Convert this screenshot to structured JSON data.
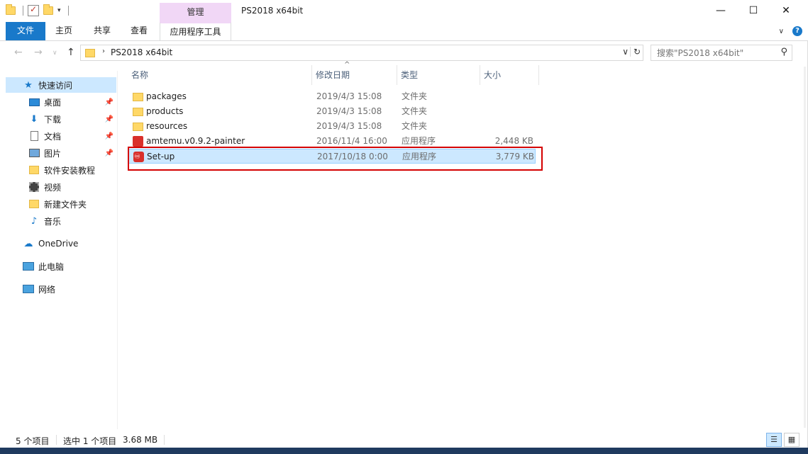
{
  "window": {
    "title": "PS2018 x64bit",
    "context_tab_group": "管理",
    "minimize": "—",
    "maximize": "☐",
    "close": "✕"
  },
  "ribbon": {
    "tabs": [
      "文件",
      "主页",
      "共享",
      "查看",
      "应用程序工具"
    ]
  },
  "address": {
    "path": "PS2018 x64bit",
    "search_placeholder": "搜索\"PS2018 x64bit\""
  },
  "nav_pane": {
    "quick_access": "快速访问",
    "items": [
      {
        "label": "桌面",
        "icon": "desktop-icon",
        "pinned": true
      },
      {
        "label": "下载",
        "icon": "download-icon",
        "pinned": true
      },
      {
        "label": "文档",
        "icon": "document-icon",
        "pinned": true
      },
      {
        "label": "图片",
        "icon": "pictures-icon",
        "pinned": true
      },
      {
        "label": "软件安装教程",
        "icon": "folder-icon",
        "pinned": false
      },
      {
        "label": "视频",
        "icon": "video-icon",
        "pinned": false
      },
      {
        "label": "新建文件夹",
        "icon": "folder-icon",
        "pinned": false
      },
      {
        "label": "音乐",
        "icon": "music-icon",
        "pinned": false
      }
    ],
    "onedrive": "OneDrive",
    "this_pc": "此电脑",
    "network": "网络"
  },
  "columns": {
    "name": "名称",
    "date": "修改日期",
    "type": "类型",
    "size": "大小"
  },
  "files": [
    {
      "name": "packages",
      "date": "2019/4/3 15:08",
      "type": "文件夹",
      "size": "",
      "icon": "folder-icon"
    },
    {
      "name": "products",
      "date": "2019/4/3 15:08",
      "type": "文件夹",
      "size": "",
      "icon": "folder-icon"
    },
    {
      "name": "resources",
      "date": "2019/4/3 15:08",
      "type": "文件夹",
      "size": "",
      "icon": "folder-icon"
    },
    {
      "name": "amtemu.v0.9.2-painter",
      "date": "2016/11/4 16:00",
      "type": "应用程序",
      "size": "2,448 KB",
      "icon": "app-icon"
    },
    {
      "name": "Set-up",
      "date": "2017/10/18 0:00",
      "type": "应用程序",
      "size": "3,779 KB",
      "icon": "adobe-setup-icon",
      "selected": true
    }
  ],
  "status": {
    "item_count": "5 个项目",
    "selected": "选中 1 个项目",
    "selected_size": "3.68 MB"
  },
  "colors": {
    "accent": "#1979ca",
    "selection": "#cce8ff",
    "context_tab": "#f1d7f6",
    "highlight_box": "#d40000"
  }
}
